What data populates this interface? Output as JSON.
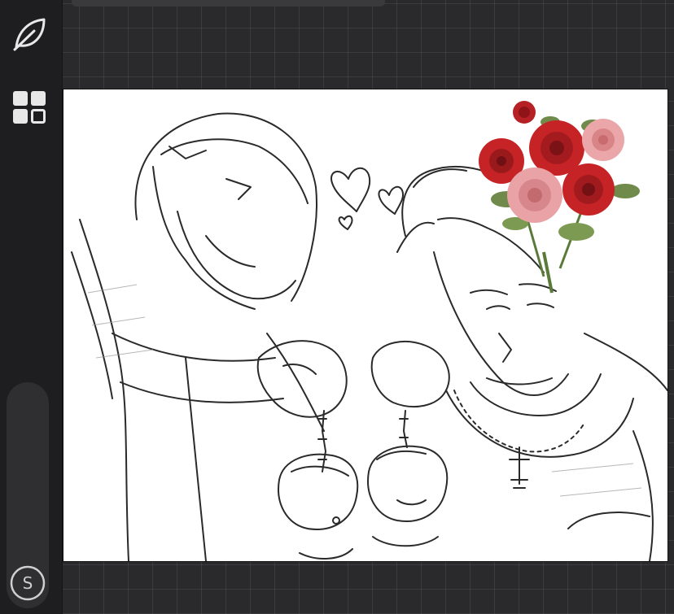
{
  "app": {
    "colors": {
      "background": "#2a2a2c",
      "sidebar": "#1e1e20",
      "canvas": "#ffffff",
      "icon": "#e8e8e8",
      "rose_red": "#c62326",
      "rose_pink": "#e9a3a6",
      "leaf_green": "#6f8a4a"
    }
  },
  "sidebar": {
    "tools": [
      {
        "icon": "leaf-icon"
      },
      {
        "icon": "gallery-grid-icon"
      }
    ],
    "size_slider": {
      "knob_label": "S"
    }
  },
  "canvas": {
    "artwork": "sketch-with-roses"
  }
}
